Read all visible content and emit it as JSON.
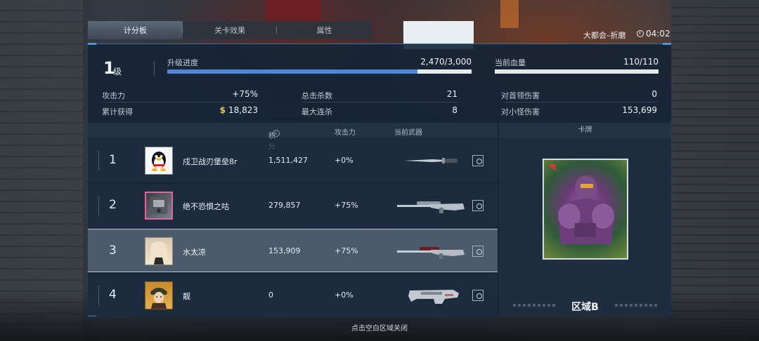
{
  "tabs": [
    {
      "label": "计分板",
      "active": true
    },
    {
      "label": "关卡效果",
      "active": false
    },
    {
      "label": "属性",
      "active": false
    }
  ],
  "header": {
    "map_name": "大都会–折磨",
    "timer": "04:02",
    "timer_icon": "clock-icon"
  },
  "level": {
    "number": "1",
    "unit": "级"
  },
  "xp": {
    "label": "升级进度",
    "value": "2,470/3,000",
    "progress": 0.823
  },
  "hp": {
    "label": "当前血量",
    "value": "110/110",
    "progress": 1.0
  },
  "stats": {
    "attack_label": "攻击力",
    "attack_value": "+75%",
    "earned_label": "累计获得",
    "earned_value": "18,823",
    "money_icon": "$",
    "kills_label": "总击杀数",
    "kills_value": "21",
    "combo_label": "最大连杀",
    "combo_value": "8",
    "boss_dmg_label": "对首领伤害",
    "boss_dmg_value": "0",
    "minion_dmg_label": "对小怪伤害",
    "minion_dmg_value": "153,699"
  },
  "table": {
    "col_score": "积分",
    "col_attack": "攻击力",
    "col_weapon": "当前武器",
    "col_card": "卡牌",
    "rows": [
      {
        "rank": "1",
        "name": "戍卫战刃堡垒8r",
        "score": "1,511,427",
        "attack": "+0%",
        "avatar": "qq-penguin",
        "weapon": "knife"
      },
      {
        "rank": "2",
        "name": "绝不恐惧之咕",
        "score": "279,857",
        "attack": "+75%",
        "avatar": "pink-frame",
        "weapon": "sniper-rifle"
      },
      {
        "rank": "3",
        "name": "水太凉",
        "score": "153,909",
        "attack": "+75%",
        "avatar": "blonde-girl",
        "weapon": "sniper-rifle"
      },
      {
        "rank": "4",
        "name": "靓",
        "score": "0",
        "attack": "+0%",
        "avatar": "soldier-girl",
        "weapon": "futuristic-rifle"
      }
    ]
  },
  "card": {
    "label": "区域B"
  },
  "footer": {
    "hint": "点击空白区域关闭"
  }
}
